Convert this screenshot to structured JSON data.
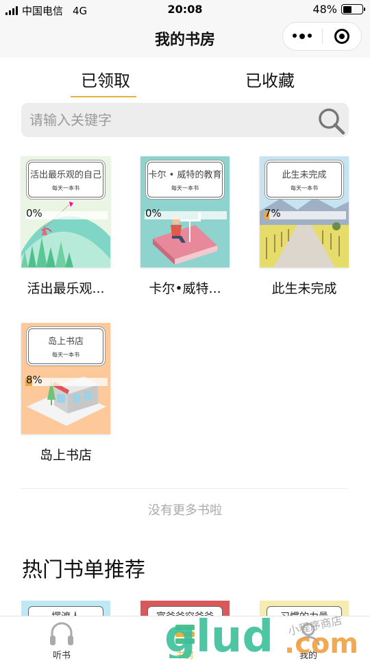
{
  "status_bar": {
    "carrier": "中国电信",
    "network": "4G",
    "time": "20:08",
    "battery_percent": "48%",
    "battery_level": 0.48
  },
  "nav": {
    "title": "我的书房"
  },
  "tabs": {
    "received": "已领取",
    "favorites": "已收藏",
    "active": "received"
  },
  "search": {
    "placeholder": "请输入关键字"
  },
  "books": [
    {
      "cover_title": "活出最乐观的自己",
      "cover_sub": "每天一本书",
      "progress_text": "0%",
      "progress": 0,
      "title": "活出最乐观...",
      "bg": "#e8f4e0"
    },
    {
      "cover_title": "卡尔 • 威特的教育",
      "cover_sub": "每天一本书",
      "progress_text": "0%",
      "progress": 0,
      "title": "卡尔•威特...",
      "bg": "#8fd3cf"
    },
    {
      "cover_title": "此生未完成",
      "cover_sub": "每天一本书",
      "progress_text": "7%",
      "progress": 0.07,
      "title": "此生未完成",
      "bg": "#bfe0f0"
    },
    {
      "cover_title": "岛上书店",
      "cover_sub": "每天一本书",
      "progress_text": "8%",
      "progress": 0.08,
      "title": "岛上书店",
      "bg": "#fdc89a"
    }
  ],
  "footer": {
    "no_more": "没有更多书啦"
  },
  "hot": {
    "title": "热门书单推荐",
    "cards": [
      {
        "label": "摆渡人",
        "bg": "#bfe8f5"
      },
      {
        "label": "富爸爸穷爸爸",
        "bg": "#d9595a"
      },
      {
        "label": "习惯的力量",
        "bg": "#f7ecb0"
      }
    ]
  },
  "tabbar": {
    "items": [
      {
        "label": "听书",
        "icon": "headphones-icon"
      },
      {
        "label": "书房",
        "icon": "bookshelf-icon"
      },
      {
        "label": "我的",
        "icon": "profile-icon"
      }
    ],
    "active": "书房"
  },
  "watermark": {
    "brand": "glud",
    "domain": ".com",
    "slogan": "小程序商店"
  },
  "colors": {
    "accent": "#e8b23a",
    "progress": "#e8a94a",
    "page_bg": "#ffffff",
    "nav_bg": "#f7f7f7"
  }
}
